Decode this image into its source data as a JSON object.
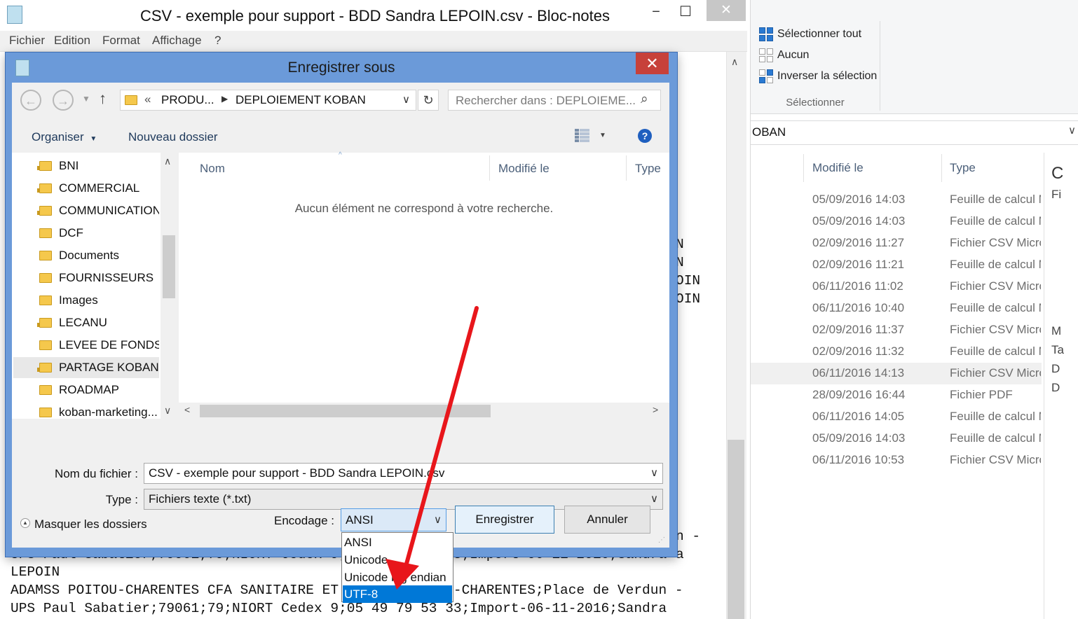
{
  "notepad": {
    "title": "CSV - exemple pour support - BDD Sandra LEPOIN.csv - Bloc-notes",
    "menu": [
      "Fichier",
      "Edition",
      "Format",
      "Affichage",
      "?"
    ],
    "window_controls": {
      "minimize": "−",
      "maximize": "☐",
      "close": "✕"
    },
    "text_fragments": [
      "N",
      "N",
      "OIN",
      "OIN",
      "n -",
      "a"
    ],
    "text_lines": [
      "UPS Paul Sabatier;79061;79;NIORT Cedex 9;05 49 79 53 33;Import-06-11-2016;Sandra",
      "LEPOIN",
      "ADAMSS POITOU-CHARENTES CFA SANITAIRE ET SOCIAL POITOU-CHARENTES;Place de Verdun -",
      "UPS Paul Sabatier;79061;79;NIORT Cedex 9;05 49 79 53 33;Import-06-11-2016;Sandra"
    ]
  },
  "dialog": {
    "title": "Enregistrer sous",
    "close": "✕",
    "address": {
      "overflow": "«",
      "crumbs": [
        "PRODU...",
        "DEPLOIEMENT KOBAN"
      ]
    },
    "search_placeholder": "Rechercher dans : DEPLOIEME...",
    "toolbar": {
      "organize": "Organiser",
      "new_folder": "Nouveau dossier",
      "help": "?"
    },
    "tree": [
      {
        "label": "BNI",
        "locked": true
      },
      {
        "label": "COMMERCIAL",
        "locked": true
      },
      {
        "label": "COMMUNICATION",
        "locked": true
      },
      {
        "label": "DCF",
        "locked": false
      },
      {
        "label": "Documents",
        "locked": false
      },
      {
        "label": "FOURNISSEURS",
        "locked": false
      },
      {
        "label": "Images",
        "locked": false
      },
      {
        "label": "LECANU",
        "locked": true
      },
      {
        "label": "LEVEE DE FONDS",
        "locked": false
      },
      {
        "label": "PARTAGE KOBAN",
        "locked": true,
        "selected": true
      },
      {
        "label": "ROADMAP",
        "locked": false
      },
      {
        "label": "koban-marketing...",
        "locked": false
      }
    ],
    "columns": [
      "Nom",
      "Modifié le",
      "Type"
    ],
    "empty_message": "Aucun élément ne correspond à votre recherche.",
    "filename_label": "Nom du fichier :",
    "filename_value": "CSV - exemple pour support - BDD Sandra LEPOIN.csv",
    "type_label": "Type :",
    "type_value": "Fichiers texte (*.txt)",
    "hide_folders": "Masquer les dossiers",
    "encoding_label": "Encodage :",
    "encoding_value": "ANSI",
    "encoding_options": [
      "ANSI",
      "Unicode",
      "Unicode big endian",
      "UTF-8"
    ],
    "encoding_highlighted": "UTF-8",
    "save_button": "Enregistrer",
    "cancel_button": "Annuler"
  },
  "explorer": {
    "ribbon": {
      "select_all": "Sélectionner tout",
      "select_none": "Aucun",
      "invert": "Inverser la sélection",
      "group_label": "Sélectionner"
    },
    "address": "OBAN",
    "columns": {
      "modified": "Modifié le",
      "type": "Type"
    },
    "rows": [
      {
        "date": "05/09/2016 14:03",
        "type": "Feuille de calcul M"
      },
      {
        "date": "05/09/2016 14:03",
        "type": "Feuille de calcul M"
      },
      {
        "date": "02/09/2016 11:27",
        "type": "Fichier CSV Micro"
      },
      {
        "date": "02/09/2016 11:21",
        "type": "Feuille de calcul M"
      },
      {
        "date": "06/11/2016 11:02",
        "type": "Fichier CSV Micro"
      },
      {
        "date": "06/11/2016 10:40",
        "type": "Feuille de calcul M"
      },
      {
        "date": "02/09/2016 11:37",
        "type": "Fichier CSV Micro"
      },
      {
        "date": "02/09/2016 11:32",
        "type": "Feuille de calcul M"
      },
      {
        "date": "06/11/2016 14:13",
        "type": "Fichier CSV Micro",
        "selected": true
      },
      {
        "date": "28/09/2016 16:44",
        "type": "Fichier PDF"
      },
      {
        "date": "06/11/2016 14:05",
        "type": "Feuille de calcul M"
      },
      {
        "date": "05/09/2016 14:03",
        "type": "Feuille de calcul M"
      },
      {
        "date": "06/11/2016 10:53",
        "type": "Fichier CSV Micro"
      }
    ],
    "preview_fragments": [
      "C",
      "Fi",
      "M",
      "Ta",
      "D",
      "D"
    ]
  },
  "colors": {
    "dialog_frame": "#6b9ad9",
    "close_red": "#c7413a",
    "highlight": "#0078d7",
    "arrow": "#e8161b"
  }
}
